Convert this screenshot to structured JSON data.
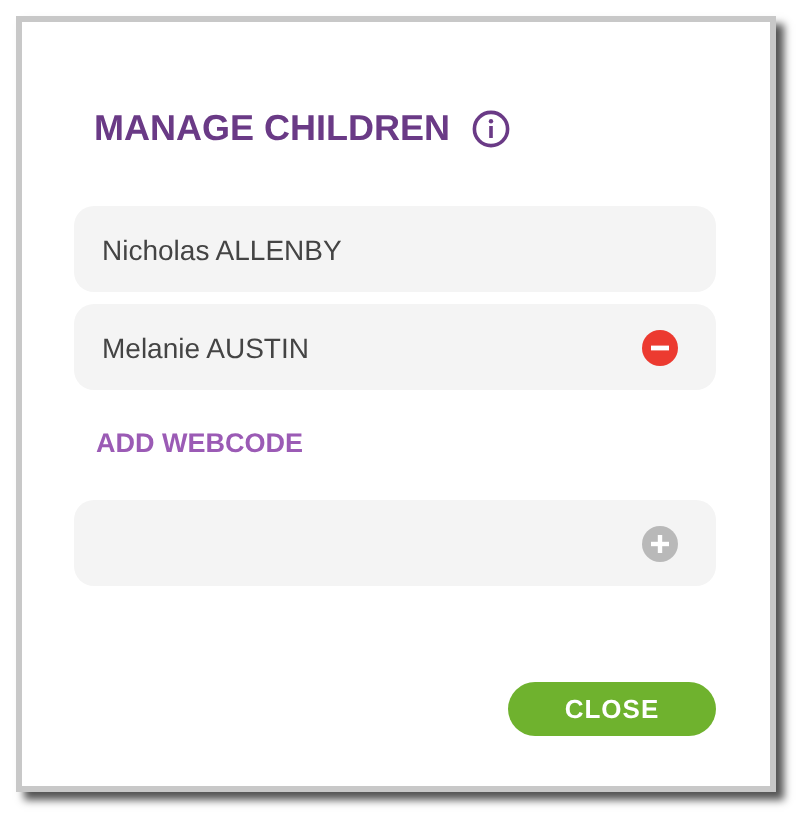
{
  "dialog": {
    "title": "MANAGE CHILDREN",
    "children": [
      {
        "name": "Nicholas ALLENBY",
        "removable": false
      },
      {
        "name": "Melanie AUSTIN",
        "removable": true
      }
    ],
    "add_webcode": {
      "label": "ADD WEBCODE"
    },
    "buttons": [
      {
        "label": "CLOSE"
      }
    ]
  }
}
